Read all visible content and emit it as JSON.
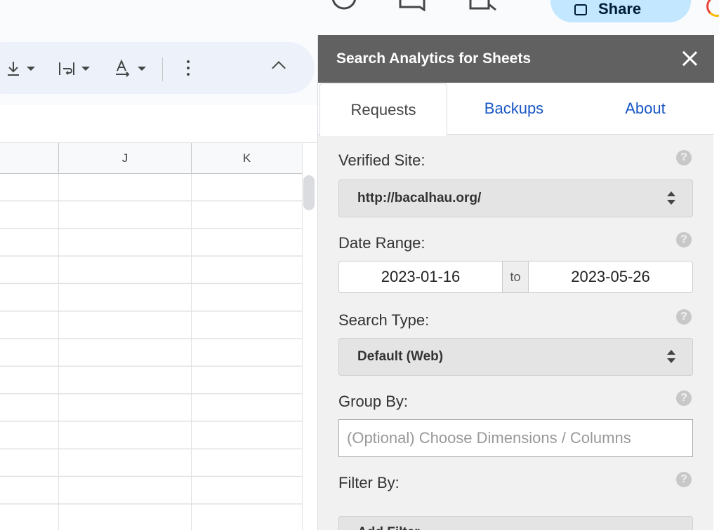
{
  "share": {
    "label": "Share"
  },
  "grid": {
    "columns": [
      "J",
      "K"
    ]
  },
  "panel": {
    "title": "Search Analytics for Sheets",
    "tabs": [
      {
        "label": "Requests",
        "active": true
      },
      {
        "label": "Backups",
        "active": false
      },
      {
        "label": "About",
        "active": false
      }
    ],
    "verified_site": {
      "label": "Verified Site:",
      "value": "http://bacalhau.org/"
    },
    "date_range": {
      "label": "Date Range:",
      "start": "2023-01-16",
      "separator": "to",
      "end": "2023-05-26"
    },
    "search_type": {
      "label": "Search Type:",
      "value": "Default (Web)"
    },
    "group_by": {
      "label": "Group By:",
      "placeholder": "(Optional) Choose Dimensions / Columns"
    },
    "filter_by": {
      "label": "Filter By:",
      "button": "Add Filter"
    },
    "help_glyph": "?"
  },
  "colors": {
    "panel_header_bg": "#616161",
    "tab_link": "#1a57c4",
    "share_bg": "#c2e7ff",
    "toolbar_bg": "#edf2fa"
  }
}
